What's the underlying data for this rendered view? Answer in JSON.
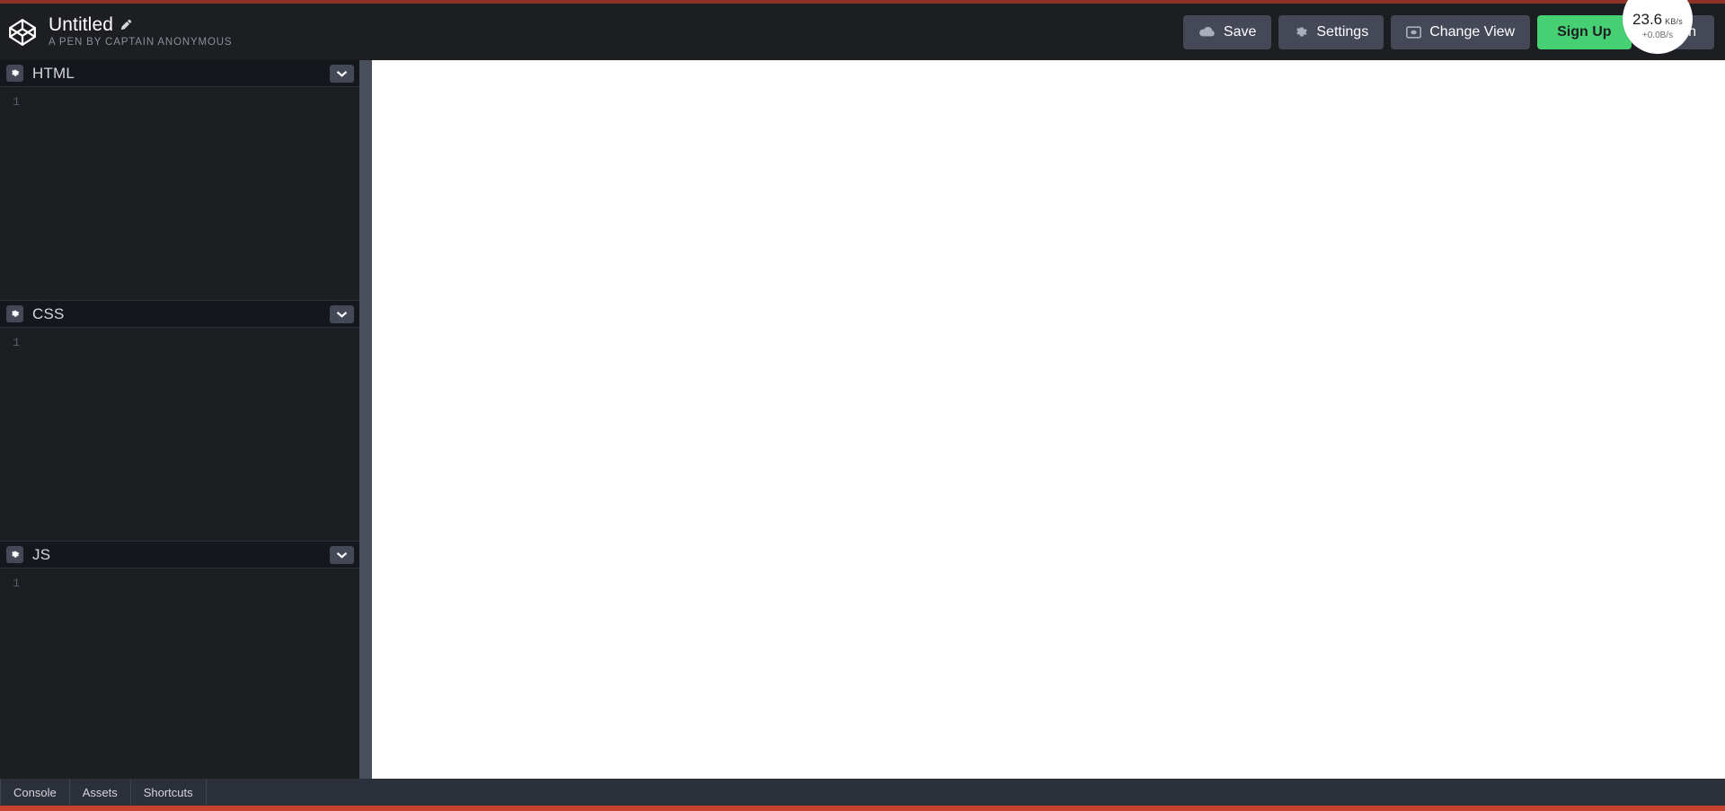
{
  "window": {
    "top_accent_color": "#8c3229",
    "bottom_accent_color": "#c8432f",
    "background": "#1d1e22"
  },
  "header": {
    "logo_icon": "codepen-logo-icon",
    "pen_title": "Untitled",
    "edit_icon": "pencil-icon",
    "pen_author": "A PEN BY CAPTAIN ANONYMOUS",
    "actions": {
      "save_label": "Save",
      "save_icon": "cloud-icon",
      "settings_label": "Settings",
      "settings_icon": "gear-icon",
      "change_view_label": "Change View",
      "change_view_icon": "screen-icon",
      "signup_label": "Sign Up",
      "login_label": "Log In",
      "signup_color": "#47cf73",
      "button_color": "#444857"
    }
  },
  "editors": [
    {
      "id": "html",
      "title": "HTML",
      "settings_icon": "gear-icon",
      "collapse_icon": "chevron-down-icon",
      "line_numbers": "1",
      "code": ""
    },
    {
      "id": "css",
      "title": "CSS",
      "settings_icon": "gear-icon",
      "collapse_icon": "chevron-down-icon",
      "line_numbers": "1",
      "code": ""
    },
    {
      "id": "js",
      "title": "JS",
      "settings_icon": "gear-icon",
      "collapse_icon": "chevron-down-icon",
      "line_numbers": "1",
      "code": ""
    }
  ],
  "preview": {
    "content": "",
    "background": "#ffffff"
  },
  "bottom_bar": {
    "items": [
      {
        "label": "Console"
      },
      {
        "label": "Assets"
      },
      {
        "label": "Shortcuts"
      }
    ]
  },
  "netspeed": {
    "value": "23.6",
    "unit": "KB/s",
    "delta": "+0.0B/s"
  }
}
